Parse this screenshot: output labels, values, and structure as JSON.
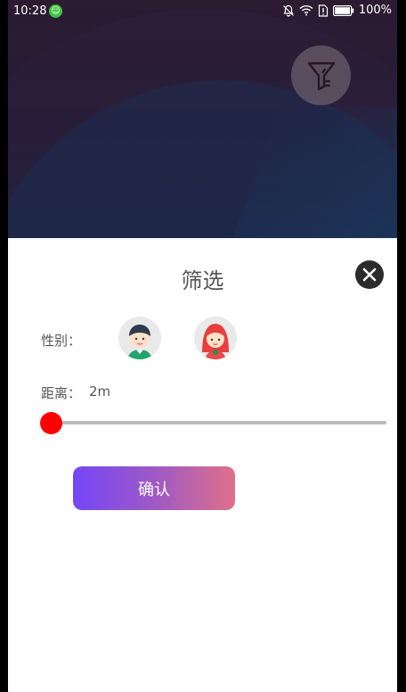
{
  "status_bar": {
    "time": "10:28",
    "battery": "100%",
    "icons": [
      "mute-bell-icon",
      "wifi-icon",
      "sim-alert-icon",
      "battery-icon"
    ]
  },
  "filter_fab": {
    "icon": "filter-icon"
  },
  "sheet": {
    "title": "筛选",
    "close_icon": "close-icon",
    "gender_label": "性别：",
    "genders": [
      "male-avatar",
      "female-avatar"
    ],
    "distance_label": "距离：",
    "distance_value": "2m",
    "distance_slider_fraction": 0.0,
    "confirm_label": "确认"
  },
  "colors": {
    "slider_thumb": "#ff0000",
    "slider_track": "#b9b9b9",
    "confirm_gradient_start": "#7446f8",
    "confirm_gradient_end": "#e07088",
    "close_button_bg": "#2b2b2b"
  }
}
